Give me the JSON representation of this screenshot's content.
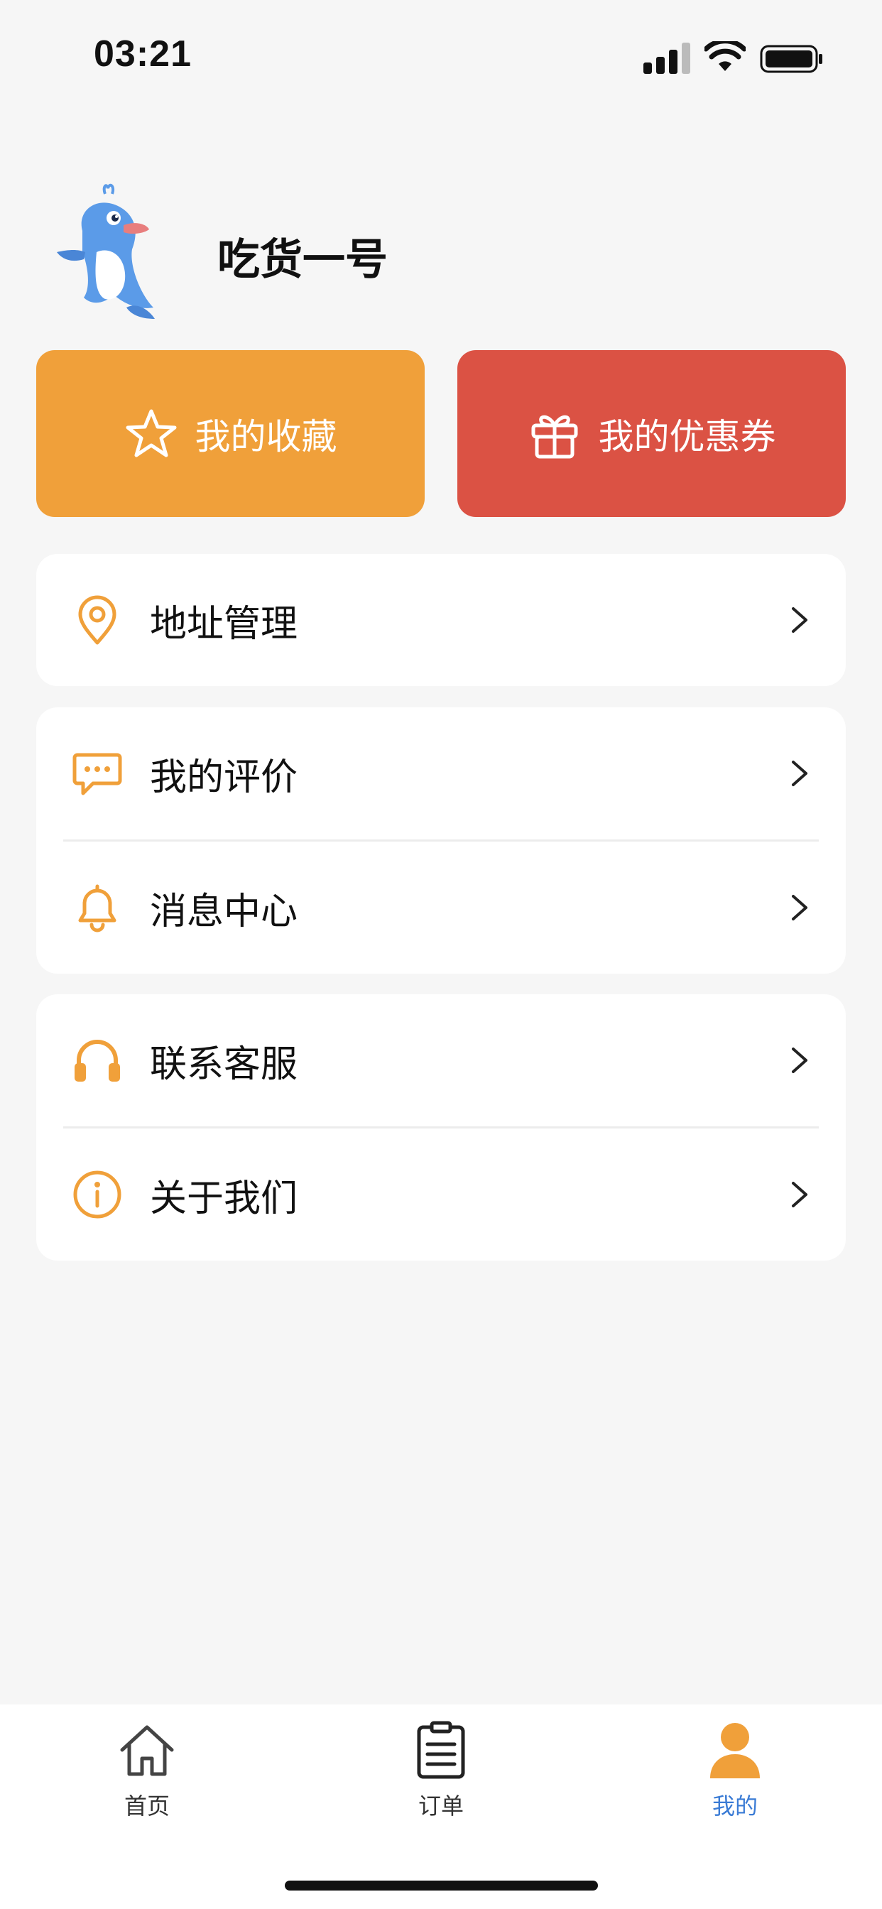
{
  "status_bar": {
    "time": "03:21"
  },
  "profile": {
    "username": "吃货一号",
    "avatar_icon": "dolphin-avatar"
  },
  "quick_actions": [
    {
      "label": "我的收藏",
      "icon": "star-icon",
      "color": "#f0a03a"
    },
    {
      "label": "我的优惠券",
      "icon": "gift-icon",
      "color": "#db5244"
    }
  ],
  "menu": {
    "address": {
      "label": "地址管理",
      "icon": "location-pin-icon"
    },
    "reviews": {
      "label": "我的评价",
      "icon": "chat-bubble-icon"
    },
    "messages": {
      "label": "消息中心",
      "icon": "bell-icon"
    },
    "support": {
      "label": "联系客服",
      "icon": "headset-icon"
    },
    "about": {
      "label": "关于我们",
      "icon": "info-icon"
    }
  },
  "tabbar": {
    "home": {
      "label": "首页",
      "icon": "home-icon"
    },
    "orders": {
      "label": "订单",
      "icon": "clipboard-icon"
    },
    "mine": {
      "label": "我的",
      "icon": "user-icon",
      "active": true
    }
  },
  "colors": {
    "accent": "#f0a03a",
    "danger": "#db5244",
    "active_tab": "#3a7bd5"
  }
}
